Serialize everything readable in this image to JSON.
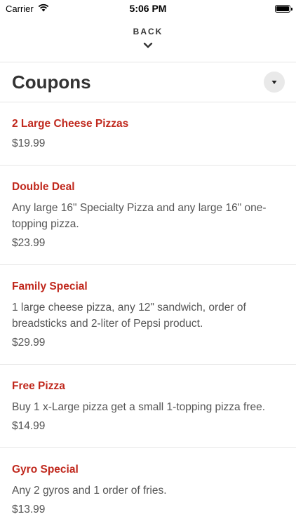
{
  "status": {
    "carrier": "Carrier",
    "time": "5:06 PM"
  },
  "nav": {
    "back_label": "BACK"
  },
  "header": {
    "title": "Coupons"
  },
  "colors": {
    "accent": "#c0281d",
    "text": "#333333",
    "muted": "#555555",
    "divider": "#e6e6e6"
  },
  "coupons": [
    {
      "title": "2 Large Cheese Pizzas",
      "description": "",
      "price": "$19.99"
    },
    {
      "title": "Double Deal",
      "description": "Any large 16\" Specialty Pizza and any large 16\" one-topping pizza.",
      "price": "$23.99"
    },
    {
      "title": "Family Special",
      "description": "1 large cheese pizza, any 12\" sandwich, order of breadsticks and 2-liter of Pepsi product.",
      "price": "$29.99"
    },
    {
      "title": "Free Pizza",
      "description": "Buy 1 x-Large pizza get a small 1-topping pizza free.",
      "price": "$14.99"
    },
    {
      "title": "Gyro Special",
      "description": "Any 2 gyros and 1 order of fries.",
      "price": "$13.99"
    }
  ]
}
